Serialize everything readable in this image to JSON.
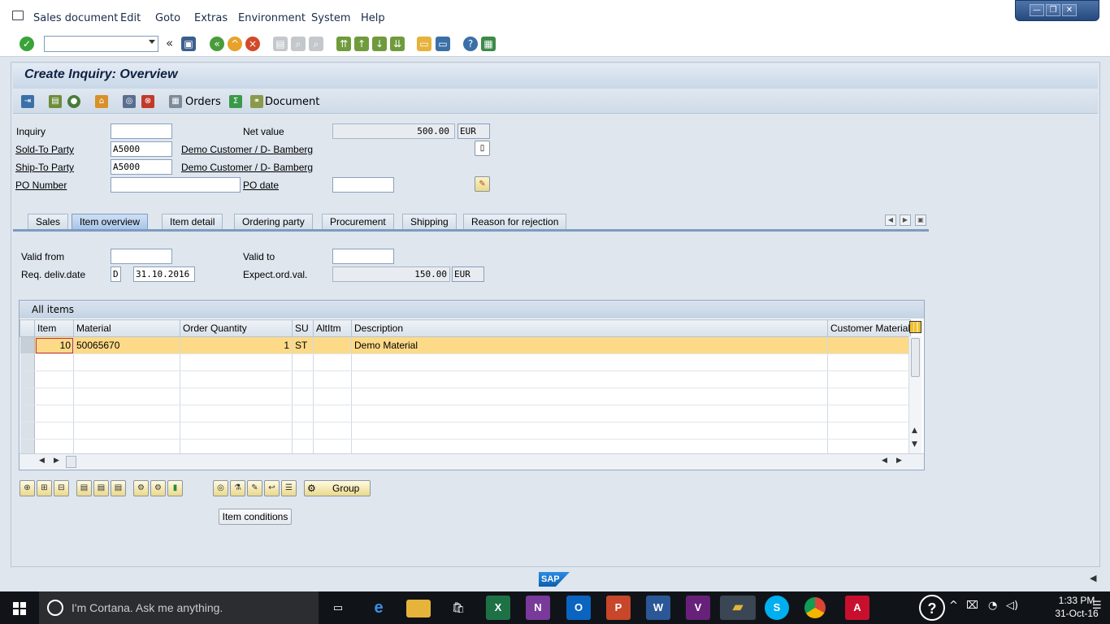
{
  "menu": [
    "Sales document",
    "Edit",
    "Goto",
    "Extras",
    "Environment",
    "System",
    "Help"
  ],
  "window_controls": {
    "minimize": "—",
    "restore": "❐",
    "close": "✕"
  },
  "title": "Create Inquiry: Overview",
  "app_toolbar": {
    "orders_label": "Orders",
    "document_label": "Document"
  },
  "header": {
    "inquiry_label": "Inquiry",
    "inquiry_value": "",
    "net_value_label": "Net value",
    "net_value": "500.00",
    "net_currency": "EUR",
    "sold_to_label": "Sold-To Party",
    "sold_to_value": "A5000",
    "sold_to_name": "Demo Customer / D- Bamberg",
    "ship_to_label": "Ship-To Party",
    "ship_to_value": "A5000",
    "ship_to_name": "Demo Customer / D- Bamberg",
    "po_number_label": "PO Number",
    "po_number_value": "",
    "po_date_label": "PO date",
    "po_date_value": ""
  },
  "tabs": [
    "Sales",
    "Item overview",
    "Item detail",
    "Ordering party",
    "Procurement",
    "Shipping",
    "Reason for rejection"
  ],
  "active_tab": "Item overview",
  "item_overview": {
    "valid_from_label": "Valid from",
    "valid_from_value": "",
    "valid_to_label": "Valid to",
    "valid_to_value": "",
    "req_deliv_label": "Req. deliv.date",
    "req_deliv_type": "D",
    "req_deliv_value": "31.10.2016",
    "expect_val_label": "Expect.ord.val.",
    "expect_val": "150.00",
    "expect_currency": "EUR"
  },
  "grid": {
    "title": "All items",
    "columns": [
      "Item",
      "Material",
      "Order Quantity",
      "SU",
      "AltItm",
      "Description",
      "Customer Material"
    ],
    "rows": [
      {
        "item": "10",
        "material": "50065670",
        "quantity": "1",
        "su": "ST",
        "altitm": "",
        "description": "Demo Material",
        "customer_material": ""
      }
    ]
  },
  "buttons": {
    "group_label": "Group",
    "item_conditions_label": "Item conditions"
  },
  "sap_logo": "SAP",
  "taskbar": {
    "search_placeholder": "I'm Cortana. Ask me anything.",
    "time": "1:33 PM",
    "date": "31-Oct-16"
  },
  "colors": {
    "selected_row": "#fdda88",
    "title_bar": "#c8d7e8",
    "taskbar": "#101418"
  }
}
